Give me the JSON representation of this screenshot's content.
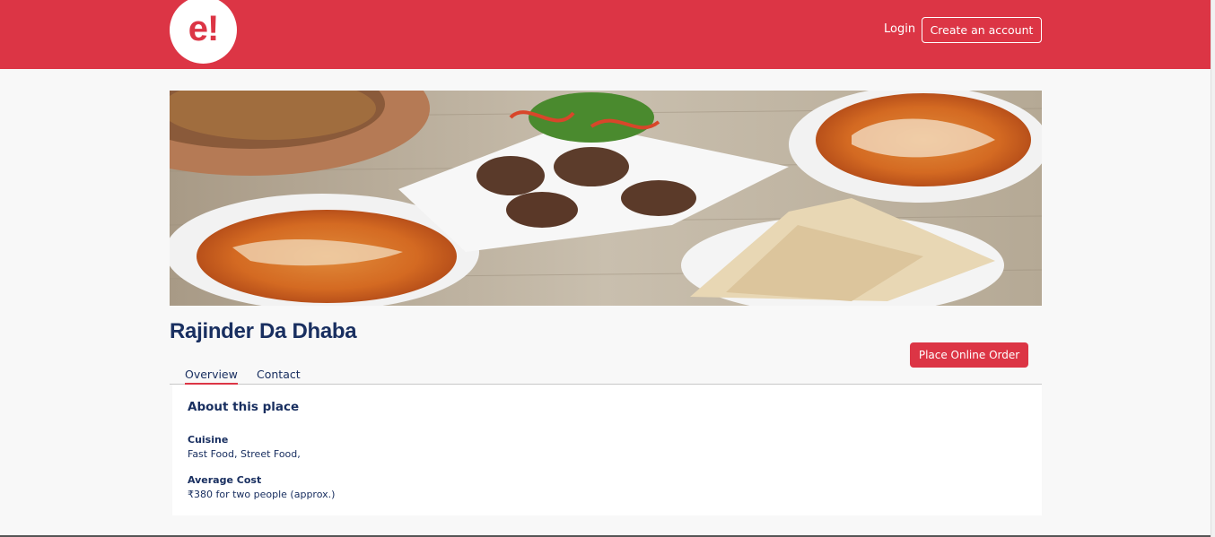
{
  "header": {
    "logo_text": "e!",
    "login_label": "Login",
    "create_account_label": "Create an account"
  },
  "colors": {
    "brand": "#dc3545",
    "text": "#192f60"
  },
  "restaurant": {
    "name": "Rajinder Da Dhaba",
    "order_button_label": "Place Online Order"
  },
  "tabs": [
    {
      "label": "Overview",
      "active": true
    },
    {
      "label": "Contact",
      "active": false
    }
  ],
  "about": {
    "heading": "About this place",
    "cuisine_label": "Cuisine",
    "cuisine_value": "Fast Food, Street Food,",
    "cost_label": "Average Cost",
    "cost_value": "₹380 for two people (approx.)"
  }
}
